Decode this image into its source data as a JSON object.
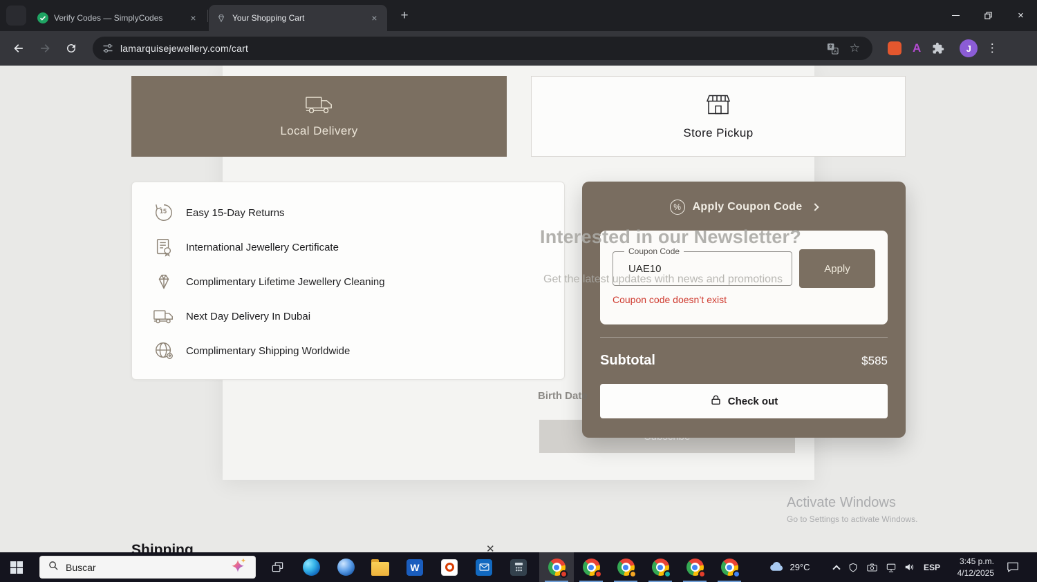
{
  "colors": {
    "accent_brown": "#7b6f61",
    "error_red": "#cf3b30",
    "page_bg": "#e9e9e7"
  },
  "browser": {
    "tabs": [
      {
        "title": "Verify Codes — SimplyCodes"
      },
      {
        "title": "Your Shopping Cart"
      }
    ],
    "url": "lamarquisejewellery.com/cart",
    "profile_initial": "J",
    "extension_a": "A"
  },
  "icons": {
    "tab_close": "×",
    "new_tab": "+",
    "window_close": "×",
    "bookmark_star": "☆",
    "menu_kebab": "⋮",
    "percent": "%",
    "section_close": "✕"
  },
  "cart": {
    "delivery_local": "Local Delivery",
    "delivery_pickup": "Store Pickup",
    "features": [
      "Easy 15-Day Returns",
      "International Jewellery Certificate",
      "Complimentary Lifetime Jewellery Cleaning",
      "Next Day Delivery In Dubai",
      "Complimentary Shipping Worldwide"
    ],
    "returns_badge": "15",
    "coupon": {
      "header": "Apply Coupon Code",
      "field_label": "Coupon Code",
      "field_value": "UAE10",
      "apply": "Apply",
      "error": "Coupon code doesn’t exist",
      "subtotal_label": "Subtotal",
      "subtotal_value": "$585",
      "checkout": "Check out"
    },
    "shipping_heading": "Shipping"
  },
  "newsletter": {
    "title": "Interested in our Newsletter?",
    "subtitle": "Get the latest updates with news and promotions",
    "birth_date": "Birth Date",
    "subscribe": "Subscribe"
  },
  "watermark": {
    "line1": "Activate Windows",
    "line2": "Go to Settings to activate Windows."
  },
  "taskbar": {
    "search": "Buscar",
    "weather": "29°C",
    "language": "ESP",
    "time": "3:45 p.m.",
    "date": "4/12/2025",
    "word_letter": "W"
  }
}
